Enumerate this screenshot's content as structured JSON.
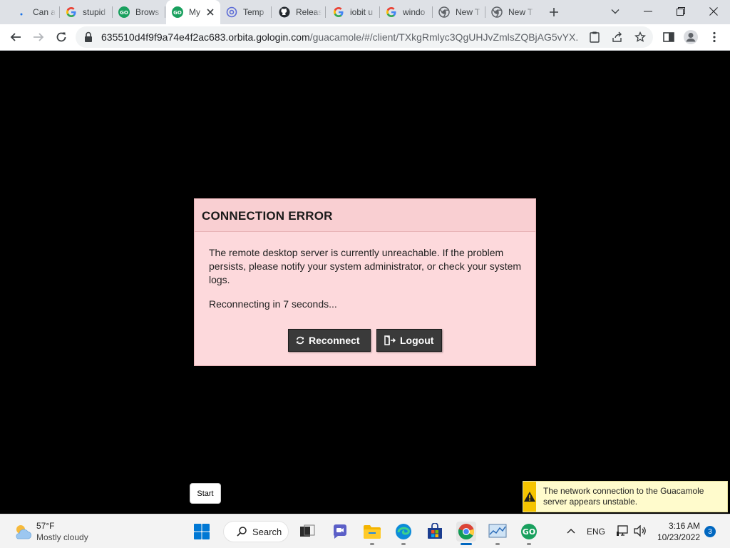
{
  "browser": {
    "tabs": [
      {
        "title": "Can a",
        "icon": "loading-dot-icon",
        "active": false
      },
      {
        "title": "stupid",
        "icon": "google-icon",
        "active": false
      },
      {
        "title": "Brows",
        "icon": "gologin-icon",
        "active": false
      },
      {
        "title": "My",
        "icon": "gologin-icon",
        "active": true
      },
      {
        "title": "Temp",
        "icon": "at-sign-icon",
        "active": false
      },
      {
        "title": "Releas",
        "icon": "github-icon",
        "active": false
      },
      {
        "title": "iobit u",
        "icon": "google-icon",
        "active": false
      },
      {
        "title": "windo",
        "icon": "google-icon",
        "active": false
      },
      {
        "title": "New T",
        "icon": "chrome-icon",
        "active": false
      },
      {
        "title": "New T",
        "icon": "chrome-icon",
        "active": false
      }
    ],
    "address": {
      "host": "635510d4f9f9a74e4f2ac683.orbita.gologin.com",
      "path": "/guacamole/#/client/TXkgRmlyc3QgUHJvZmlsZQBjAG5vYX..."
    }
  },
  "dialog": {
    "title": "CONNECTION ERROR",
    "message": "The remote desktop server is currently unreachable. If the problem persists, please notify your system administrator, or check your system logs.",
    "status": "Reconnecting in 7 seconds...",
    "reconnect_label": "Reconnect",
    "logout_label": "Logout"
  },
  "tooltip": {
    "text": "Start"
  },
  "notification": {
    "text": "The network connection to the Guacamole server appears unstable.",
    "icon": "warning-icon"
  },
  "taskbar": {
    "weather": {
      "temp": "57°F",
      "desc": "Mostly cloudy",
      "icon": "partly-cloudy-icon"
    },
    "search_label": "Search",
    "lang": "ENG",
    "time": "3:16 AM",
    "date": "10/23/2022",
    "notification_count": "3"
  },
  "colors": {
    "dialog_bg": "#fdd9dc",
    "dialog_border": "#e8b3b6",
    "button_bg": "#3a3a3a",
    "notify_bg": "#fffbcc",
    "warning": "#f5c400",
    "taskbar_bg": "#f3f3f3",
    "accent": "#0067c0"
  }
}
